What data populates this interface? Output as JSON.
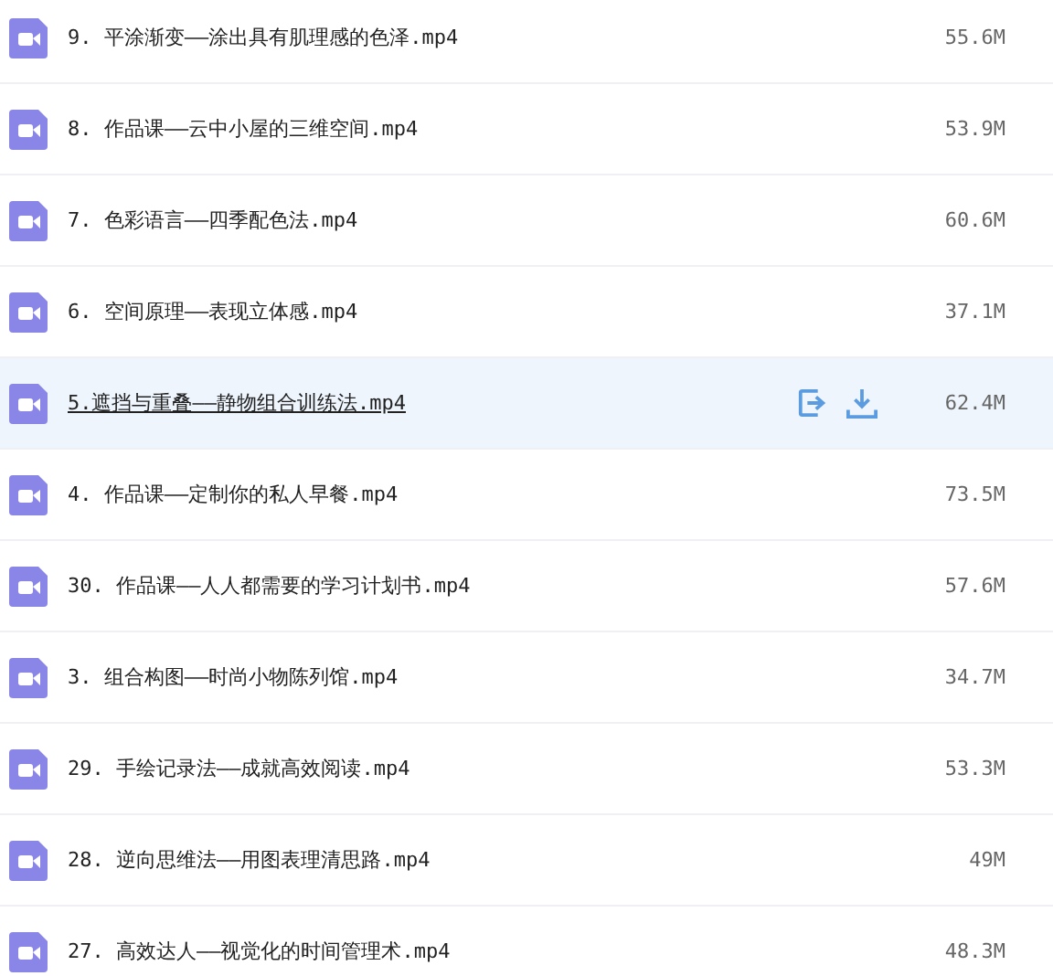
{
  "files": [
    {
      "name": "9. 平涂渐变——涂出具有肌理感的色泽.mp4",
      "size": "55.6M",
      "selected": false
    },
    {
      "name": "8. 作品课——云中小屋的三维空间.mp4",
      "size": "53.9M",
      "selected": false
    },
    {
      "name": "7. 色彩语言——四季配色法.mp4",
      "size": "60.6M",
      "selected": false
    },
    {
      "name": "6. 空间原理——表现立体感.mp4",
      "size": "37.1M",
      "selected": false
    },
    {
      "name": "5.遮挡与重叠——静物组合训练法.mp4",
      "size": "62.4M",
      "selected": true
    },
    {
      "name": "4. 作品课——定制你的私人早餐.mp4",
      "size": "73.5M",
      "selected": false
    },
    {
      "name": "30. 作品课——人人都需要的学习计划书.mp4",
      "size": "57.6M",
      "selected": false
    },
    {
      "name": "3. 组合构图——时尚小物陈列馆.mp4",
      "size": "34.7M",
      "selected": false
    },
    {
      "name": "29. 手绘记录法——成就高效阅读.mp4",
      "size": "53.3M",
      "selected": false
    },
    {
      "name": "28. 逆向思维法——用图表理清思路.mp4",
      "size": "49M",
      "selected": false
    },
    {
      "name": "27. 高效达人——视觉化的时间管理术.mp4",
      "size": "48.3M",
      "selected": false
    }
  ]
}
